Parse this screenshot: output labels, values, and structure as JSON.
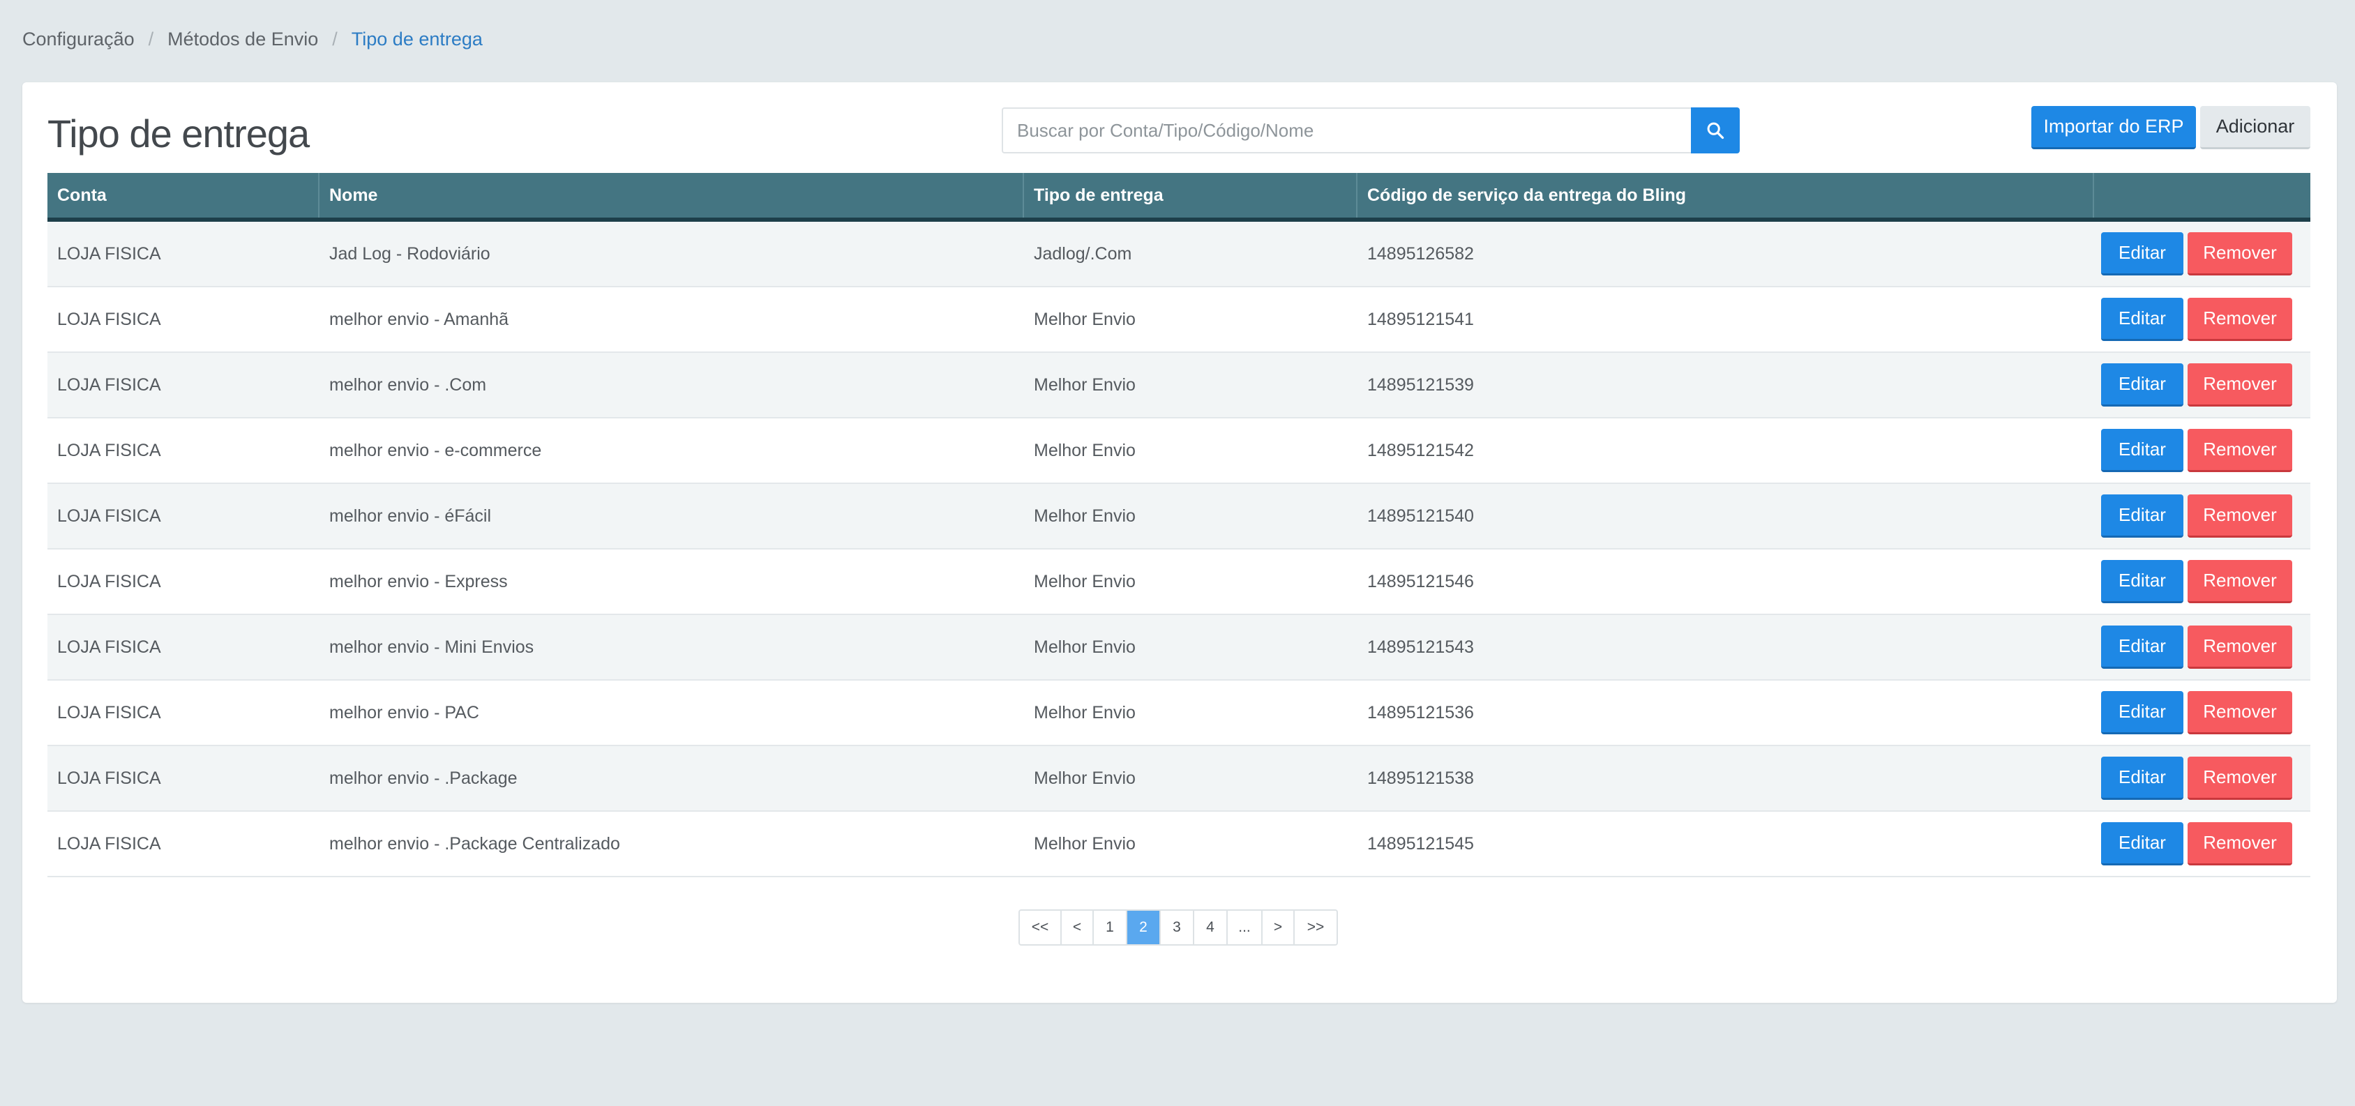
{
  "breadcrumb": {
    "items": [
      "Configuração",
      "Métodos de Envio",
      "Tipo de entrega"
    ],
    "separator": "/"
  },
  "page": {
    "title": "Tipo de entrega"
  },
  "search": {
    "placeholder": "Buscar por Conta/Tipo/Código/Nome",
    "value": "",
    "icon": "search-icon"
  },
  "toolbar": {
    "import_label": "Importar do ERP",
    "add_label": "Adicionar"
  },
  "table": {
    "columns": [
      "Conta",
      "Nome",
      "Tipo de entrega",
      "Código de serviço da entrega do Bling",
      ""
    ],
    "rows": [
      {
        "conta": "LOJA FISICA",
        "nome": "Jad Log - Rodoviário",
        "tipo": "Jadlog/.Com",
        "codigo": "14895126582"
      },
      {
        "conta": "LOJA FISICA",
        "nome": "melhor envio - Amanhã",
        "tipo": "Melhor Envio",
        "codigo": "14895121541"
      },
      {
        "conta": "LOJA FISICA",
        "nome": "melhor envio - .Com",
        "tipo": "Melhor Envio",
        "codigo": "14895121539"
      },
      {
        "conta": "LOJA FISICA",
        "nome": "melhor envio - e-commerce",
        "tipo": "Melhor Envio",
        "codigo": "14895121542"
      },
      {
        "conta": "LOJA FISICA",
        "nome": "melhor envio - éFácil",
        "tipo": "Melhor Envio",
        "codigo": "14895121540"
      },
      {
        "conta": "LOJA FISICA",
        "nome": "melhor envio - Express",
        "tipo": "Melhor Envio",
        "codigo": "14895121546"
      },
      {
        "conta": "LOJA FISICA",
        "nome": "melhor envio - Mini Envios",
        "tipo": "Melhor Envio",
        "codigo": "14895121543"
      },
      {
        "conta": "LOJA FISICA",
        "nome": "melhor envio - PAC",
        "tipo": "Melhor Envio",
        "codigo": "14895121536"
      },
      {
        "conta": "LOJA FISICA",
        "nome": "melhor envio - .Package",
        "tipo": "Melhor Envio",
        "codigo": "14895121538"
      },
      {
        "conta": "LOJA FISICA",
        "nome": "melhor envio - .Package Centralizado",
        "tipo": "Melhor Envio",
        "codigo": "14895121545"
      }
    ],
    "edit_label": "Editar",
    "remove_label": "Remover"
  },
  "pagination": {
    "first": "<<",
    "prev": "<",
    "pages": [
      "1",
      "2",
      "3",
      "4"
    ],
    "current": "2",
    "ellipsis": "...",
    "next": ">",
    "last": ">>"
  },
  "colors": {
    "background": "#e2e8eb",
    "primary": "#1e88e5",
    "danger": "#f75a5f",
    "table_header": "#447582",
    "active_link": "#2c7cc4",
    "active_page": "#5aa8ef"
  }
}
